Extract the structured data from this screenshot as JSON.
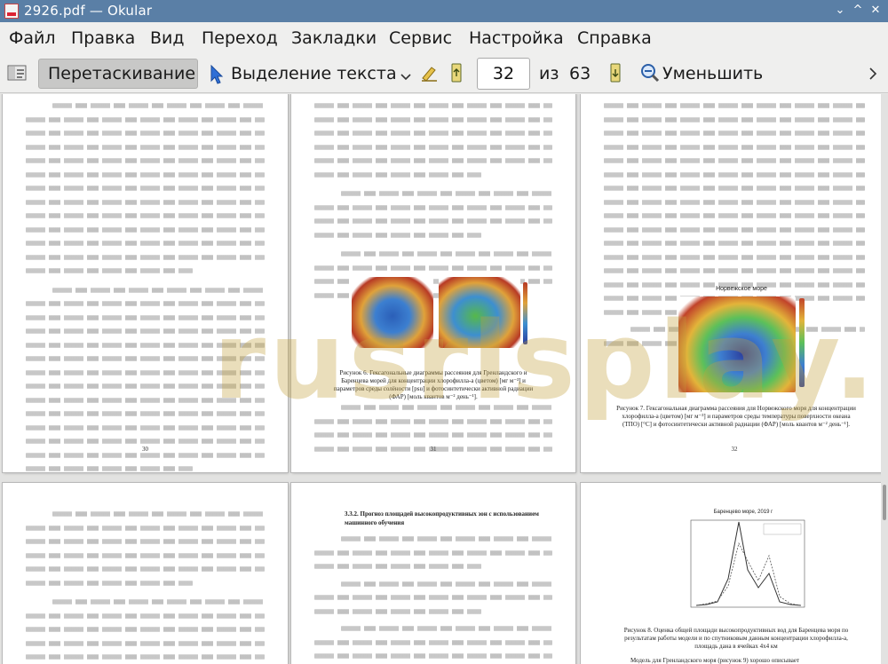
{
  "window": {
    "title": "2926.pdf — Okular",
    "controls": [
      "⌄",
      "^",
      "✕"
    ]
  },
  "menu": [
    "Файл",
    "Правка",
    "Вид",
    "Переход",
    "Закладки",
    "Сервис",
    "Настройка",
    "Справка"
  ],
  "toolbar": {
    "drag_label": "Перетаскивание",
    "select_label": "Выделение текста",
    "page_current": "32",
    "page_of": "из",
    "page_total": "63",
    "zoom_out_label": "Уменьшить"
  },
  "pages": {
    "p30": {
      "number": "30"
    },
    "p31": {
      "number": "31",
      "fig_caption": "Рисунок 6. Гексагональные диаграммы рассеяния для Гренландского и Баренцева морей для концентрации хлорофилла-а (цветом) [мг м⁻³] и параметров среды солёности [рsu] и фотосинтетически активной радиации (ФАР) [моль квантов м⁻² день⁻¹]."
    },
    "p32": {
      "number": "32",
      "fig_title": "Норвежское море",
      "fig_caption": "Рисунок 7. Гексагональная диаграмма рассеяния для Норвежского моря для концентрации хлорофилла-а (цветом) [мг м⁻³] и параметров среды температуры поверхности океана (ТПО) [°C] и фотосинтетически активной радиации (ФАР) [моль квантов м⁻² день⁻¹]."
    },
    "p34": {
      "heading": "3.3.2. Прогноз площадей высокопродуктивных зон с использованием машинного обучения"
    },
    "p35": {
      "chart_title": "Баренцево море, 2019 г",
      "fig_caption": "Рисунок 8. Оценка общей площади высокопродуктивных вод для Баренцева моря по результатам работы модели и по спутниковым данным концентрации хлорофилла-а, площадь дана в ячейках 4х4 км",
      "tail": "Модель для Гренландского моря (рисунок 9) хорошо описывает"
    }
  },
  "watermark": "rusrlsplay.ru"
}
